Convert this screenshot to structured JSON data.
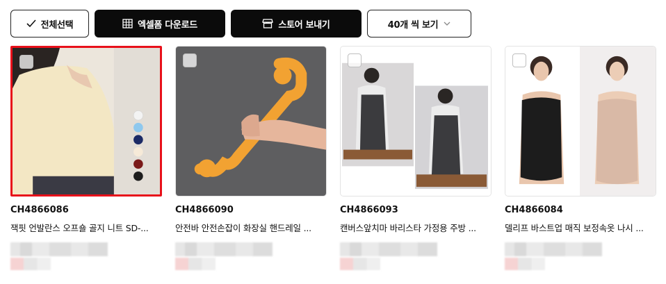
{
  "toolbar": {
    "select_all": "전체선택",
    "excel_download": "엑셀폼 다운로드",
    "send_to_store": "스토어 보내기",
    "view_count": "40개 씩 보기"
  },
  "products": [
    {
      "code": "CH4866086",
      "title": "잭핏 언발란스 오프숄 골지 니트 SD-...",
      "selected": true
    },
    {
      "code": "CH4866090",
      "title": "안전바 안전손잡이 화장실 핸드레일 ...",
      "selected": false
    },
    {
      "code": "CH4866093",
      "title": "캔버스앞치마 바리스타 가정용 주방 ...",
      "selected": false
    },
    {
      "code": "CH4866084",
      "title": "델리프 바스트업 매직 보정속옷 나시 ...",
      "selected": false
    }
  ],
  "colors": {
    "selected_border": "#e8101a",
    "dark_button": "#0b0b0b"
  },
  "icons": [
    "check-icon",
    "spreadsheet-icon",
    "store-icon",
    "chevron-down-icon"
  ]
}
